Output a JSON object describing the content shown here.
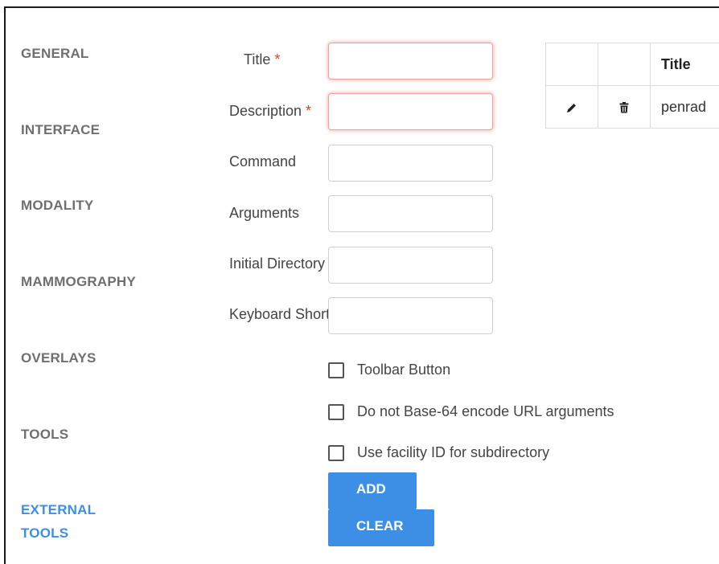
{
  "sidebar": {
    "items": [
      {
        "label": "GENERAL"
      },
      {
        "label": "INTERFACE"
      },
      {
        "label": "MODALITY"
      },
      {
        "label": "MAMMOGRAPHY"
      },
      {
        "label": "OVERLAYS"
      },
      {
        "label": "TOOLS"
      },
      {
        "label": "EXTERNAL",
        "label2": "TOOLS"
      }
    ],
    "active_color": "#3d8fe6"
  },
  "form": {
    "fields": [
      {
        "label": "Title",
        "required": "*",
        "value": ""
      },
      {
        "label": "Description",
        "required": "*",
        "value": ""
      },
      {
        "label": "Command",
        "value": ""
      },
      {
        "label": "Arguments",
        "value": ""
      },
      {
        "label": "Initial Directory",
        "value": ""
      },
      {
        "label": "Keyboard Shortcut",
        "value": ""
      }
    ],
    "checkboxes": [
      {
        "label": "Toolbar Button"
      },
      {
        "label": "Do not Base-64 encode URL arguments"
      },
      {
        "label": "Use facility ID for subdirectory"
      }
    ],
    "buttons": {
      "add": "ADD",
      "clear": "CLEAR"
    }
  },
  "table": {
    "headers": [
      "",
      "",
      "Title"
    ],
    "rows": [
      {
        "edit_icon": "pencil-icon",
        "delete_icon": "trash-icon",
        "title": "penrad"
      }
    ]
  },
  "colors": {
    "accent": "#3d8fe6",
    "error": "#e53935"
  }
}
